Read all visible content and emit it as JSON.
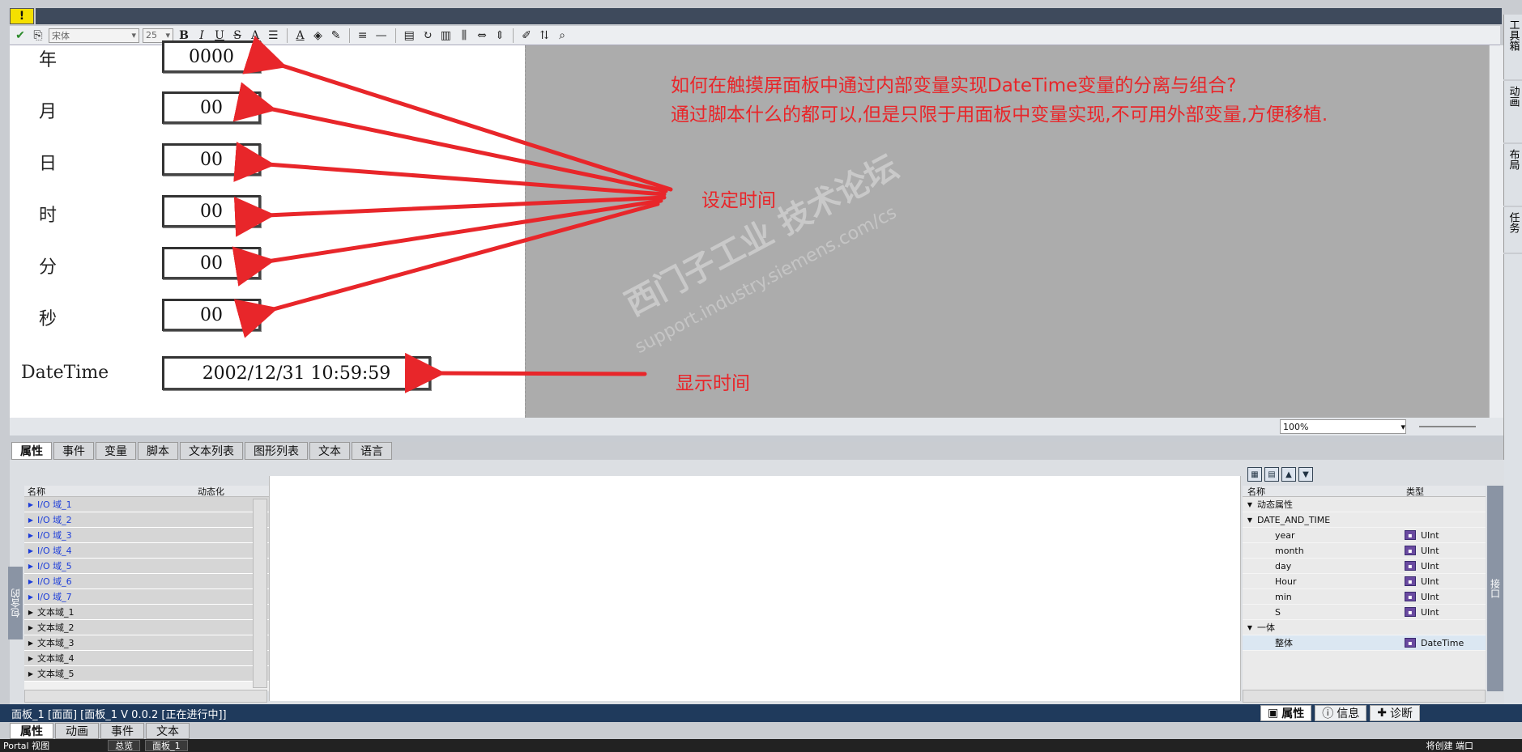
{
  "warning_badge": "!",
  "toolbar": {
    "font_name": "宋体",
    "font_size": "25",
    "bold": "B",
    "italic": "I",
    "underline": "U",
    "strike": "S",
    "font_grow": "A",
    "font_color": "A"
  },
  "screen": {
    "labels": [
      "年",
      "月",
      "日",
      "时",
      "分",
      "秒"
    ],
    "fields": [
      "0000",
      "00",
      "00",
      "00",
      "00",
      "00"
    ],
    "datetime_label": "DateTime",
    "datetime_value": "2002/12/31 10:59:59"
  },
  "annotations": {
    "question_line1": "如何在触摸屏面板中通过内部变量实现DateTime变量的分离与组合?",
    "question_line2": "通过脚本什么的都可以,但是只限于用面板中变量实现,不可用外部变量,方便移植.",
    "set_time": "设定时间",
    "show_time": "显示时间"
  },
  "watermark": {
    "text1": "西门子工业  技术论坛",
    "text2": "support.industry.siemens.com/cs"
  },
  "right_tabs": [
    "工具箱",
    "动画",
    "布局",
    "任务"
  ],
  "zoom": "100%",
  "tabs": [
    "属性",
    "事件",
    "变量",
    "脚本",
    "文本列表",
    "图形列表",
    "文本",
    "语言"
  ],
  "left_list": {
    "side_label": "包含的",
    "col_name": "名称",
    "col_dynamic": "动态化",
    "items": [
      "I/O 域_1",
      "I/O 域_2",
      "I/O 域_3",
      "I/O 域_4",
      "I/O 域_5",
      "I/O 域_6",
      "I/O 域_7",
      "文本域_1",
      "文本域_2",
      "文本域_3",
      "文本域_4",
      "文本域_5"
    ]
  },
  "right_list": {
    "side_label": "接口",
    "col_name": "名称",
    "col_type": "类型",
    "group1": "动态属性",
    "group2": "DATE_AND_TIME",
    "items": [
      {
        "name": "year",
        "type": "UInt"
      },
      {
        "name": "month",
        "type": "UInt"
      },
      {
        "name": "day",
        "type": "UInt"
      },
      {
        "name": "Hour",
        "type": "UInt"
      },
      {
        "name": "min",
        "type": "UInt"
      },
      {
        "name": "S",
        "type": "UInt"
      }
    ],
    "group3": "一体",
    "whole": {
      "name": "整体",
      "type": "DateTime"
    }
  },
  "status_bar": "面板_1 [面面] [面板_1 V 0.0.2 [正在进行中]]",
  "bottom_right_tabs": [
    "属性",
    "信息",
    "诊断"
  ],
  "bottom_tabs": [
    "属性",
    "动画",
    "事件",
    "文本"
  ],
  "taskbar": {
    "left": "Portal 视图",
    "item1": "总览",
    "item2": "面板_1",
    "right": "将创建 端口"
  }
}
